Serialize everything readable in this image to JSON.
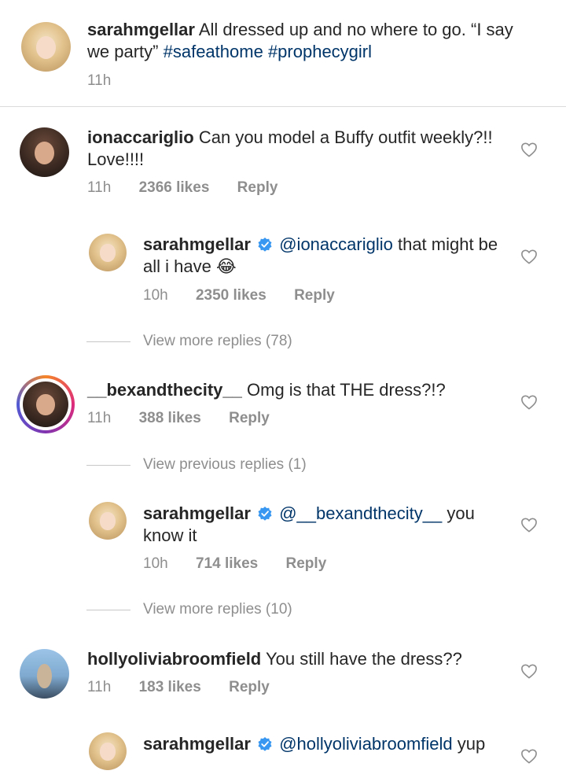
{
  "post": {
    "username": "sarahmgellar",
    "caption": "All dressed up and no where to go. “I say we party”",
    "hashtags": [
      "#safeathome",
      "#prophecygirl"
    ],
    "time": "11h"
  },
  "comments": [
    {
      "username": "ionaccariglio",
      "text": "Can you model a Buffy outfit weekly?!! Love!!!!",
      "time": "11h",
      "likes": "2366 likes",
      "reply": "Reply",
      "replies": [
        {
          "username": "sarahmgellar",
          "verified": true,
          "mention": "@ionaccariglio",
          "text": "that might be all i have",
          "emoji": "😂",
          "time": "10h",
          "likes": "2350 likes",
          "reply": "Reply"
        }
      ],
      "view_more": "View more replies (78)"
    },
    {
      "username": "__bexandthecity__",
      "text": "Omg is that THE dress?!?",
      "time": "11h",
      "likes": "388 likes",
      "reply": "Reply",
      "view_previous": "View previous replies (1)",
      "replies": [
        {
          "username": "sarahmgellar",
          "verified": true,
          "mention": "@__bexandthecity__",
          "text": "you know it",
          "time": "10h",
          "likes": "714 likes",
          "reply": "Reply"
        }
      ],
      "view_more": "View more replies (10)"
    },
    {
      "username": "hollyoliviabroomfield",
      "text": "You still have the dress??",
      "time": "11h",
      "likes": "183 likes",
      "reply": "Reply",
      "replies": [
        {
          "username": "sarahmgellar",
          "verified": true,
          "mention": "@hollyoliviabroomfield",
          "text": "yup"
        }
      ]
    }
  ],
  "icons": {
    "like": "heart-outline-icon",
    "verified": "verified-badge-icon"
  },
  "colors": {
    "link": "#003569",
    "meta": "#8e8e8e",
    "verified": "#3897f0",
    "text": "#262626"
  }
}
